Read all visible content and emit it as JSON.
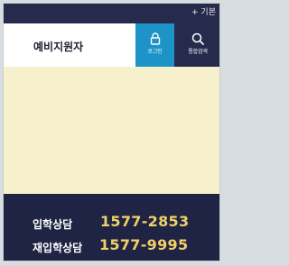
{
  "topbar": {
    "utility_text": "+ 기본"
  },
  "header": {
    "brand": "예비지원자",
    "login_label": "로그인",
    "search_label": "통합검색"
  },
  "hotline": {
    "rows": [
      {
        "label": "입학상담",
        "number": "1577-2853"
      },
      {
        "label": "재입학상담",
        "number": "1577-9995"
      }
    ]
  },
  "colors": {
    "topbar": "#262b4e",
    "login_button": "#1d93c7",
    "search_button": "#262b4e",
    "content_bg": "#f6f1cc",
    "hotline_bg": "#1f2444",
    "hotline_number": "#f2d069"
  },
  "icons": {
    "login": "lock-icon",
    "search": "search-icon"
  }
}
